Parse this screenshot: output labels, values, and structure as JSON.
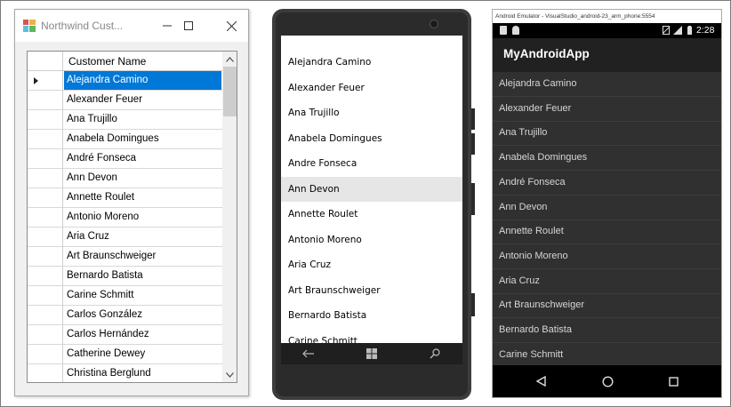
{
  "customers": [
    "Alejandra Camino",
    "Alexander Feuer",
    "Ana Trujillo",
    "Anabela Domingues",
    "André Fonseca",
    "Ann Devon",
    "Annette Roulet",
    "Antonio Moreno",
    "Aria Cruz",
    "Art Braunschweiger",
    "Bernardo Batista",
    "Carine Schmitt",
    "Carlos González",
    "Carlos Hernández",
    "Catherine Dewey",
    "Christina Berglund"
  ],
  "winforms": {
    "title": "Northwind Cust...",
    "column_header": "Customer Name",
    "selected_index": 0,
    "selection_color": "#0078d7"
  },
  "windows_phone": {
    "items": [
      "Alejandra Camino",
      "Alexander Feuer",
      "Ana Trujillo",
      "Anabela Domingues",
      "Andre Fonseca",
      "Ann Devon",
      "Annette Roulet",
      "Antonio Moreno",
      "Aria Cruz",
      "Art Braunschweiger",
      "Bernardo Batista",
      "Carine Schmitt"
    ],
    "selected_index": 5,
    "nav_icons": [
      "back-icon",
      "windows-start-icon",
      "search-icon"
    ]
  },
  "android": {
    "caption": "Android Emulator - VisualStudio_android-23_arm_phone:5554",
    "status_time": "2:28",
    "app_title": "MyAndroidApp",
    "nav_icons": [
      "back-triangle-icon",
      "home-circle-icon",
      "recents-square-icon"
    ]
  }
}
